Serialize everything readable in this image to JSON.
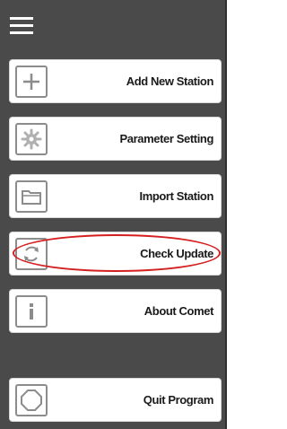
{
  "menu": {
    "toggle_icon": "hamburger-icon",
    "items": [
      {
        "label": "Add New Station",
        "icon": "plus-icon"
      },
      {
        "label": "Parameter Setting",
        "icon": "gear-icon"
      },
      {
        "label": "Import Station",
        "icon": "folder-icon"
      },
      {
        "label": "Check Update",
        "icon": "refresh-icon",
        "highlighted": true
      },
      {
        "label": "About Comet",
        "icon": "info-icon"
      },
      {
        "label": "Quit Program",
        "icon": "stop-icon"
      }
    ]
  },
  "colors": {
    "panel_bg": "#4a4a4a",
    "item_bg": "#ffffff",
    "icon_stroke": "#8c8c8c",
    "highlight": "#d42020"
  }
}
